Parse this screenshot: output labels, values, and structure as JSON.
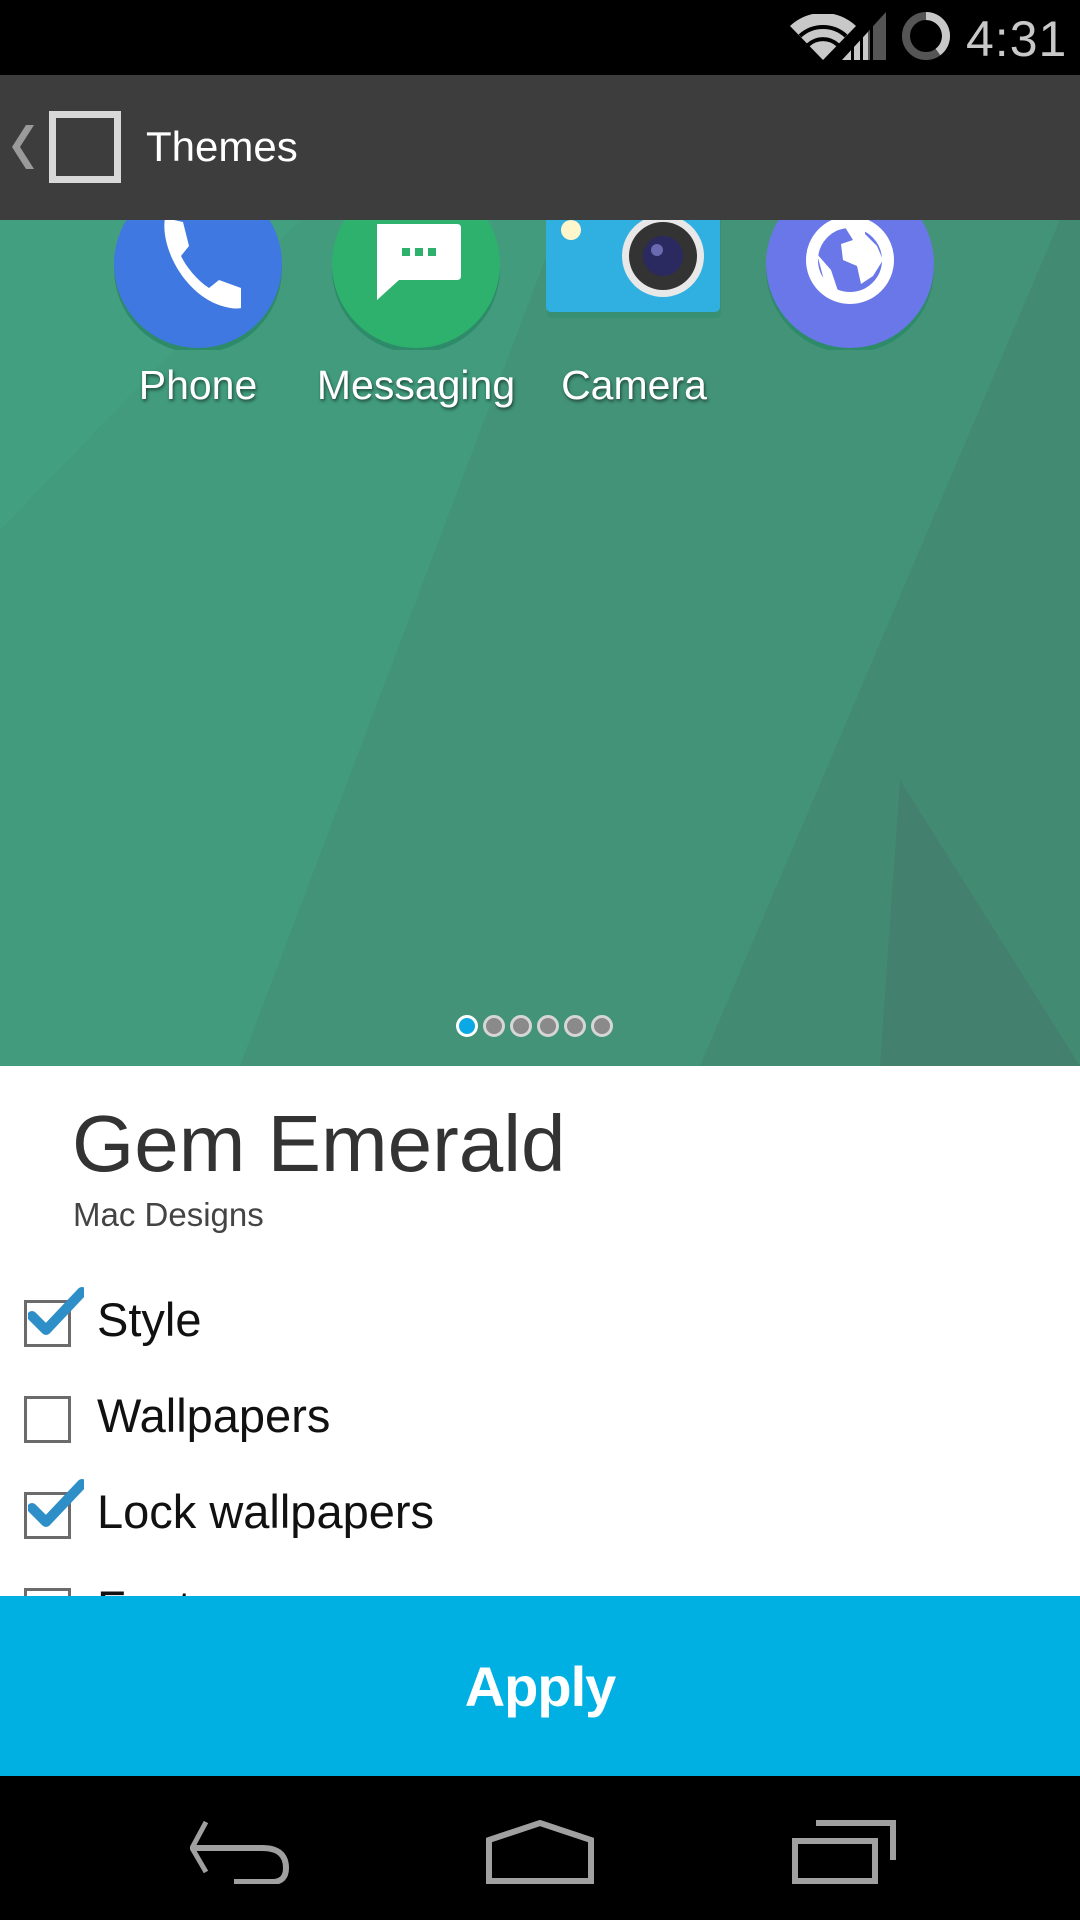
{
  "status_bar": {
    "time": "4:31",
    "icons": [
      "wifi-icon",
      "cell-signal-icon",
      "battery-icon"
    ]
  },
  "action_bar": {
    "title": "Themes",
    "up_icon": "chevron-left-icon",
    "app_icon": "square-icon"
  },
  "preview": {
    "background_color": "#429a7c",
    "apps": [
      {
        "label": "Phone",
        "icon": "phone-icon",
        "color": "#3f78e0"
      },
      {
        "label": "Messaging",
        "icon": "message-icon",
        "color": "#2eb16c"
      },
      {
        "label": "Camera",
        "icon": "camera-icon",
        "color": "#2fb0e0"
      },
      {
        "label": "",
        "icon": "globe-icon",
        "color": "#6a77e8"
      }
    ],
    "page_indicator": {
      "count": 6,
      "active_index": 0,
      "active_color": "#0aa9e6"
    }
  },
  "theme": {
    "name": "Gem Emerald",
    "author": "Mac Designs"
  },
  "components": [
    {
      "label": "Style",
      "checked": true
    },
    {
      "label": "Wallpapers",
      "checked": false
    },
    {
      "label": "Lock wallpapers",
      "checked": true
    },
    {
      "label": "Fonts",
      "checked": false
    }
  ],
  "apply_button": {
    "label": "Apply",
    "color": "#00b0e3"
  },
  "nav_bar": {
    "icons": [
      "back-icon",
      "home-icon",
      "recents-icon"
    ]
  }
}
